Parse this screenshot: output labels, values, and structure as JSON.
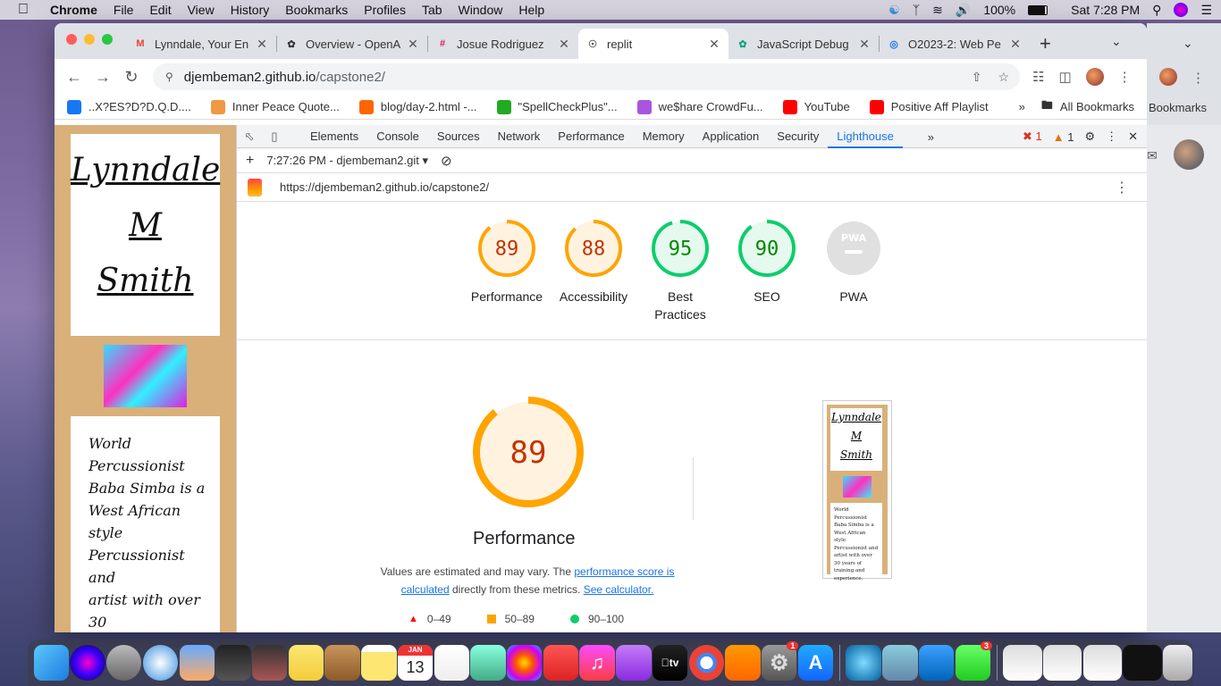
{
  "menubar": {
    "app": "Chrome",
    "items": [
      "File",
      "Edit",
      "View",
      "History",
      "Bookmarks",
      "Profiles",
      "Tab",
      "Window",
      "Help"
    ],
    "battery": "100%",
    "clock": "Sat 7:28 PM"
  },
  "tabs": [
    {
      "title": "Lynndale, Your En",
      "favicon": "gmail-icon",
      "active": false
    },
    {
      "title": "Overview - OpenA",
      "favicon": "openai-icon",
      "active": false
    },
    {
      "title": "Josue Rodriguez",
      "favicon": "slack-icon",
      "active": false
    },
    {
      "title": "replit",
      "favicon": "globe-icon",
      "active": true
    },
    {
      "title": "JavaScript Debug",
      "favicon": "chatgpt-icon",
      "active": false
    },
    {
      "title": "O2023-2: Web Pe",
      "favicon": "codex-icon",
      "active": false
    }
  ],
  "omnibox": {
    "host": "djembeman2.github.io",
    "path": "/capstone2/"
  },
  "bookmarks": [
    {
      "label": "..X?ES?D?D.Q.D....",
      "color": "#1877f2"
    },
    {
      "label": "Inner Peace Quote...",
      "color": "#e94"
    },
    {
      "label": "blog/day-2.html -...",
      "color": "#f60"
    },
    {
      "label": "\"SpellCheckPlus\"...",
      "color": "#2a2"
    },
    {
      "label": "we$hare CrowdFu...",
      "color": "#a5d"
    },
    {
      "label": "YouTube",
      "color": "#f00"
    },
    {
      "label": "Positive Aff Playlist",
      "color": "#f00"
    }
  ],
  "bookmarks_right": {
    "more": "»",
    "all": "All Bookmarks",
    "other": "Bookmarks"
  },
  "site": {
    "name_lines": [
      "Lynndale",
      "M",
      "Smith"
    ],
    "bio_lines": [
      "World",
      "Percussionist",
      "Baba Simba is a",
      "West African",
      "style",
      "Percussionist and",
      "artist with over 30",
      "years of training",
      "and experience."
    ]
  },
  "devtools": {
    "tabs": [
      "Elements",
      "Console",
      "Sources",
      "Network",
      "Performance",
      "Memory",
      "Application",
      "Security",
      "Lighthouse"
    ],
    "active_tab": "Lighthouse",
    "errors": "1",
    "warnings": "1",
    "report_time": "7:27:26 PM - djembeman2.git",
    "url": "https://djembeman2.github.io/capstone2/"
  },
  "scores": [
    {
      "label": "Performance",
      "value": "89",
      "level": "average",
      "fraction": 0.89
    },
    {
      "label": "Accessibility",
      "value": "88",
      "level": "average",
      "fraction": 0.88
    },
    {
      "label": "Best Practices",
      "value": "95",
      "level": "pass",
      "fraction": 0.95
    },
    {
      "label": "SEO",
      "value": "90",
      "level": "pass",
      "fraction": 0.9
    },
    {
      "label": "PWA",
      "value": "PWA",
      "level": "na",
      "fraction": 0
    }
  ],
  "perf_detail": {
    "score": "89",
    "fraction": 0.89,
    "title": "Performance",
    "note_before": "Values are estimated and may vary. The ",
    "note_link1": "performance score is calculated",
    "note_middle": " directly from these metrics. ",
    "note_link2": "See calculator.",
    "legend": [
      "0–49",
      "50–89",
      "90–100"
    ]
  },
  "thumbnail": {
    "name_lines": [
      "Lynndale",
      "M",
      "Smith"
    ],
    "bio": "World Percussionist Baba Simba is a West African style Percussionist and artist with over 30 years of training and experience."
  },
  "colors": {
    "average": "#ffa400",
    "average_bg": "#fff3e0",
    "average_text": "#c33300",
    "pass": "#0cce6b",
    "pass_bg": "#e6f9ef",
    "pass_text": "#008800",
    "na": "#e0e0e0",
    "fail": "#ff0000",
    "site_bg": "#d9b07a"
  },
  "dock": {
    "items": [
      "finder-icon",
      "siri-icon",
      "launchpad-icon",
      "safari-icon",
      "eagle-icon",
      "app-icon",
      "guitar-icon",
      "stickies-icon",
      "contacts-icon",
      "notes-icon",
      "calendar-icon",
      "reminders-icon",
      "maps-icon",
      "photos-icon",
      "news-icon",
      "music-icon",
      "podcasts-icon",
      "tv-icon",
      "chrome-icon",
      "books-icon",
      "system-preferences-icon",
      "app-store-icon"
    ],
    "calendar_day": "13",
    "calendar_month": "JAN",
    "settings_badge": "1",
    "messages_badge": "3"
  }
}
